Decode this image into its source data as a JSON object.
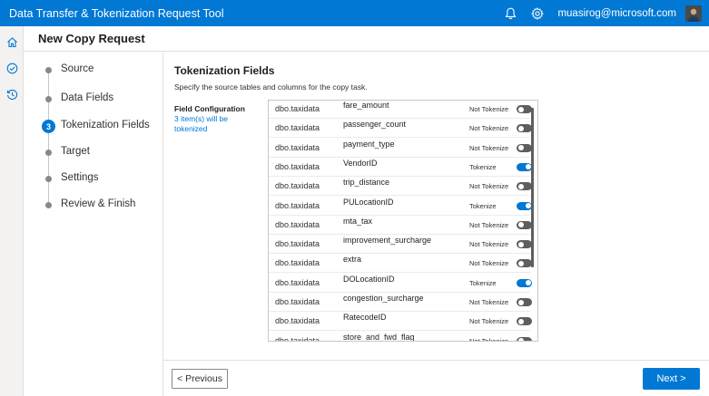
{
  "app": {
    "title": "Data Transfer & Tokenization Request Tool",
    "user_email": "muasirog@microsoft.com",
    "icons": {
      "bell": "bell-icon",
      "settings": "gear-icon",
      "avatar": "avatar"
    }
  },
  "left_rail": {
    "items": [
      {
        "icon": "home-icon"
      },
      {
        "icon": "check-circle-icon"
      },
      {
        "icon": "history-icon"
      }
    ]
  },
  "page": {
    "title": "New Copy Request"
  },
  "steps": [
    {
      "label": "Source",
      "state": "done"
    },
    {
      "label": "Data Fields",
      "state": "done"
    },
    {
      "label": "Tokenization Fields",
      "state": "current",
      "number": "3"
    },
    {
      "label": "Target",
      "state": "pending"
    },
    {
      "label": "Settings",
      "state": "pending"
    },
    {
      "label": "Review & Finish",
      "state": "pending"
    }
  ],
  "section": {
    "title": "Tokenization Fields",
    "description": "Specify the source tables and columns for the copy task.",
    "field_config_label": "Field Configuration",
    "tokenized_count": "3 item(s) will be tokenized"
  },
  "fields": [
    {
      "table": "dbo.taxidata",
      "column": "fare_amount",
      "status": "Not Tokenize",
      "on": false
    },
    {
      "table": "dbo.taxidata",
      "column": "passenger_count",
      "status": "Not Tokenize",
      "on": false
    },
    {
      "table": "dbo.taxidata",
      "column": "payment_type",
      "status": "Not Tokenize",
      "on": false
    },
    {
      "table": "dbo.taxidata",
      "column": "VendorID",
      "status": "Tokenize",
      "on": true
    },
    {
      "table": "dbo.taxidata",
      "column": "trip_distance",
      "status": "Not Tokenize",
      "on": false
    },
    {
      "table": "dbo.taxidata",
      "column": "PULocationID",
      "status": "Tokenize",
      "on": true
    },
    {
      "table": "dbo.taxidata",
      "column": "mta_tax",
      "status": "Not Tokenize",
      "on": false
    },
    {
      "table": "dbo.taxidata",
      "column": "improvement_surcharge",
      "status": "Not Tokenize",
      "on": false
    },
    {
      "table": "dbo.taxidata",
      "column": "extra",
      "status": "Not Tokenize",
      "on": false
    },
    {
      "table": "dbo.taxidata",
      "column": "DOLocationID",
      "status": "Tokenize",
      "on": true
    },
    {
      "table": "dbo.taxidata",
      "column": "congestion_surcharge",
      "status": "Not Tokenize",
      "on": false
    },
    {
      "table": "dbo.taxidata",
      "column": "RatecodeID",
      "status": "Not Tokenize",
      "on": false
    },
    {
      "table": "dbo.taxidata",
      "column": "store_and_fwd_flag",
      "status": "Not Tokenize",
      "on": false
    }
  ],
  "footer": {
    "previous_label": "< Previous",
    "next_label": "Next >"
  },
  "colors": {
    "accent": "#0078d4",
    "toggle_off": "#605e5c"
  }
}
